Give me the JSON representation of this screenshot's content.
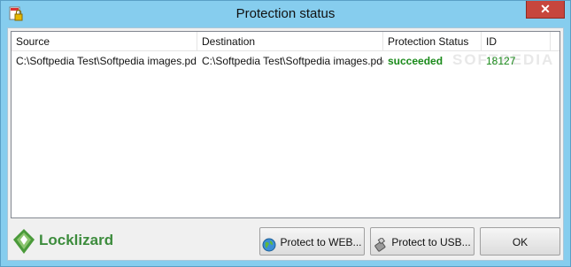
{
  "window": {
    "title": "Protection status",
    "close_label": "✕"
  },
  "table": {
    "columns": [
      "Source",
      "Destination",
      "Protection Status",
      "ID"
    ],
    "rows": [
      {
        "source": "C:\\Softpedia Test\\Softpedia images.pd...",
        "destination": "C:\\Softpedia Test\\Softpedia images.pdc",
        "status": "succeeded",
        "id": "18127"
      }
    ]
  },
  "logo": {
    "text": "Locklizard"
  },
  "buttons": {
    "web": "Protect to WEB...",
    "usb": "Protect to USB...",
    "ok": "OK"
  },
  "colors": {
    "status_success": "#1a8a1a",
    "titlebar": "#86cdee",
    "close": "#c7463d",
    "logo": "#3d8c3d"
  },
  "icons": [
    "lock-app-icon",
    "globe-icon",
    "usb-icon",
    "locklizard-logo-icon"
  ]
}
